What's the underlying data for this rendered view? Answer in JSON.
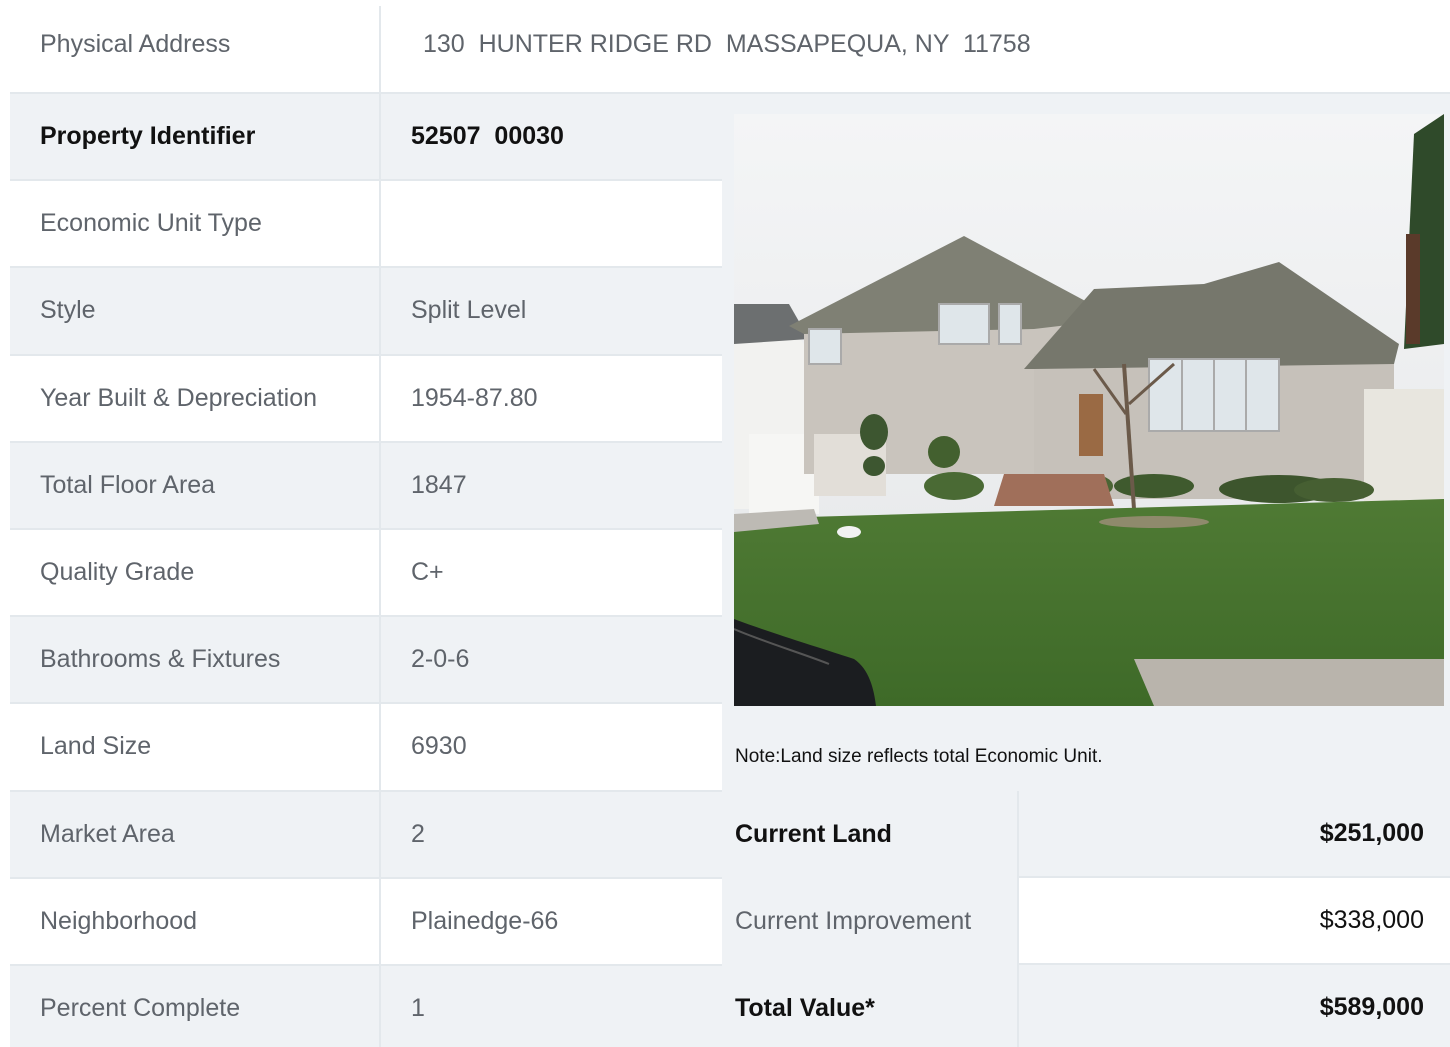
{
  "address": {
    "label": "Physical Address",
    "value": "130  HUNTER RIDGE RD  MASSAPEQUA, NY  11758"
  },
  "details": [
    {
      "label": "Property Identifier",
      "value": "52507  00030",
      "bold": true
    },
    {
      "label": "Economic Unit Type",
      "value": ""
    },
    {
      "label": "Style",
      "value": "Split Level"
    },
    {
      "label": "Year Built & Depreciation",
      "value": "1954-87.80"
    },
    {
      "label": "Total Floor Area",
      "value": "1847"
    },
    {
      "label": "Quality Grade",
      "value": "C+"
    },
    {
      "label": "Bathrooms & Fixtures",
      "value": "2-0-6"
    },
    {
      "label": "Land Size",
      "value": "6930"
    },
    {
      "label": "Market Area",
      "value": "2"
    },
    {
      "label": "Neighborhood",
      "value": "Plainedge-66"
    },
    {
      "label": "Percent Complete",
      "value": "1"
    }
  ],
  "note": "Note:Land size reflects total Economic Unit.",
  "values": [
    {
      "label": "Current Land",
      "value": "$251,000",
      "bold": true
    },
    {
      "label": "Current Improvement",
      "value": "$338,000"
    },
    {
      "label": "Total Value*",
      "value": "$589,000",
      "bold": true
    }
  ],
  "colors": {
    "row_shade": "#eff2f5",
    "text_muted": "#5f646b",
    "text_strong": "#111111",
    "border": "#e3e8ec"
  }
}
